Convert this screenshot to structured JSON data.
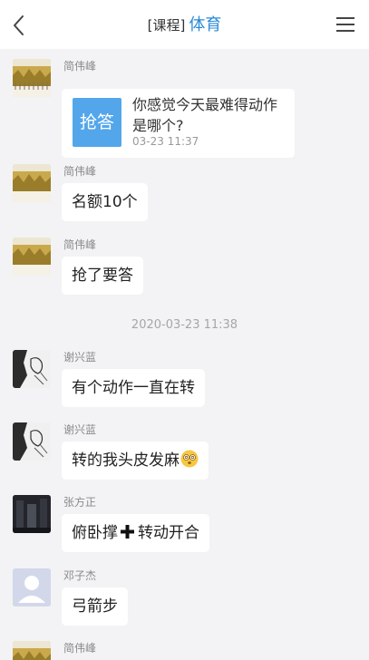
{
  "header": {
    "back_icon": "chevron-left-icon",
    "prefix": "[课程]",
    "title": "体育",
    "menu_icon": "hamburger-menu-icon"
  },
  "messages": [
    {
      "type": "question",
      "sender": "简伟峰",
      "badge": "抢答",
      "question": "你感觉今天最难得动作是哪个?",
      "time": "03-23 11:37"
    },
    {
      "type": "text",
      "sender": "简伟峰",
      "text": "名额10个"
    },
    {
      "type": "text",
      "sender": "简伟峰",
      "text": "抢了要答"
    },
    {
      "type": "timestamp",
      "text": "2020-03-23 11:38"
    },
    {
      "type": "text",
      "sender": "谢兴蓝",
      "text": "有个动作一直在转"
    },
    {
      "type": "text",
      "sender": "谢兴蓝",
      "text": "转的我头皮发麻",
      "emoji": "dizzy-face-emoji"
    },
    {
      "type": "text",
      "sender": "张方正",
      "text_before": "俯卧撑",
      "icon": "heavy-plus-icon",
      "text_after": "转动开合"
    },
    {
      "type": "text",
      "sender": "邓子杰",
      "text": "弓箭步"
    },
    {
      "type": "text",
      "sender": "简伟峰",
      "text": ""
    }
  ],
  "colors": {
    "accent": "#2b8ad8",
    "badge": "#53a6ea",
    "background": "#f3f3f5"
  }
}
